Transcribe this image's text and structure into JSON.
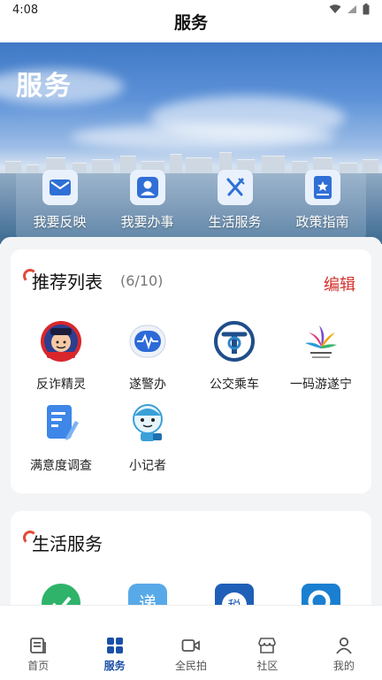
{
  "status_bar": {
    "time": "4:08"
  },
  "header": {
    "title": "服务"
  },
  "hero": {
    "title": "服务",
    "quick_actions": [
      {
        "label": "我要反映",
        "icon": "mail-icon"
      },
      {
        "label": "我要办事",
        "icon": "person-icon"
      },
      {
        "label": "生活服务",
        "icon": "fork-knife-icon"
      },
      {
        "label": "政策指南",
        "icon": "book-star-icon"
      }
    ]
  },
  "recommend": {
    "title": "推荐列表",
    "count": "(6/10)",
    "edit_label": "编辑",
    "apps": [
      {
        "label": "反诈精灵",
        "icon": "anti-fraud-police-icon"
      },
      {
        "label": "遂警办",
        "icon": "pulse-cloud-icon"
      },
      {
        "label": "公交乘车",
        "icon": "bus-t-logo-icon"
      },
      {
        "label": "一码游遂宁",
        "icon": "suining-tourism-logo-icon"
      },
      {
        "label": "满意度调查",
        "icon": "document-pen-icon"
      },
      {
        "label": "小记者",
        "icon": "reporter-mascot-icon"
      }
    ]
  },
  "life": {
    "title": "生活服务",
    "apps": [
      {
        "icon": "green-check-app-icon"
      },
      {
        "icon": "deliver-app-icon"
      },
      {
        "icon": "tax-app-icon"
      },
      {
        "icon": "search-app-icon"
      }
    ]
  },
  "bottom_nav": {
    "items": [
      {
        "label": "首页",
        "icon": "newspaper-icon"
      },
      {
        "label": "服务",
        "icon": "grid-icon"
      },
      {
        "label": "全民拍",
        "icon": "video-camera-icon"
      },
      {
        "label": "社区",
        "icon": "storefront-icon"
      },
      {
        "label": "我的",
        "icon": "user-icon"
      }
    ],
    "active": "服务"
  },
  "colors": {
    "accent": "#1a4fa8",
    "edit": "#d4312b",
    "marker": "#e24a3b"
  }
}
